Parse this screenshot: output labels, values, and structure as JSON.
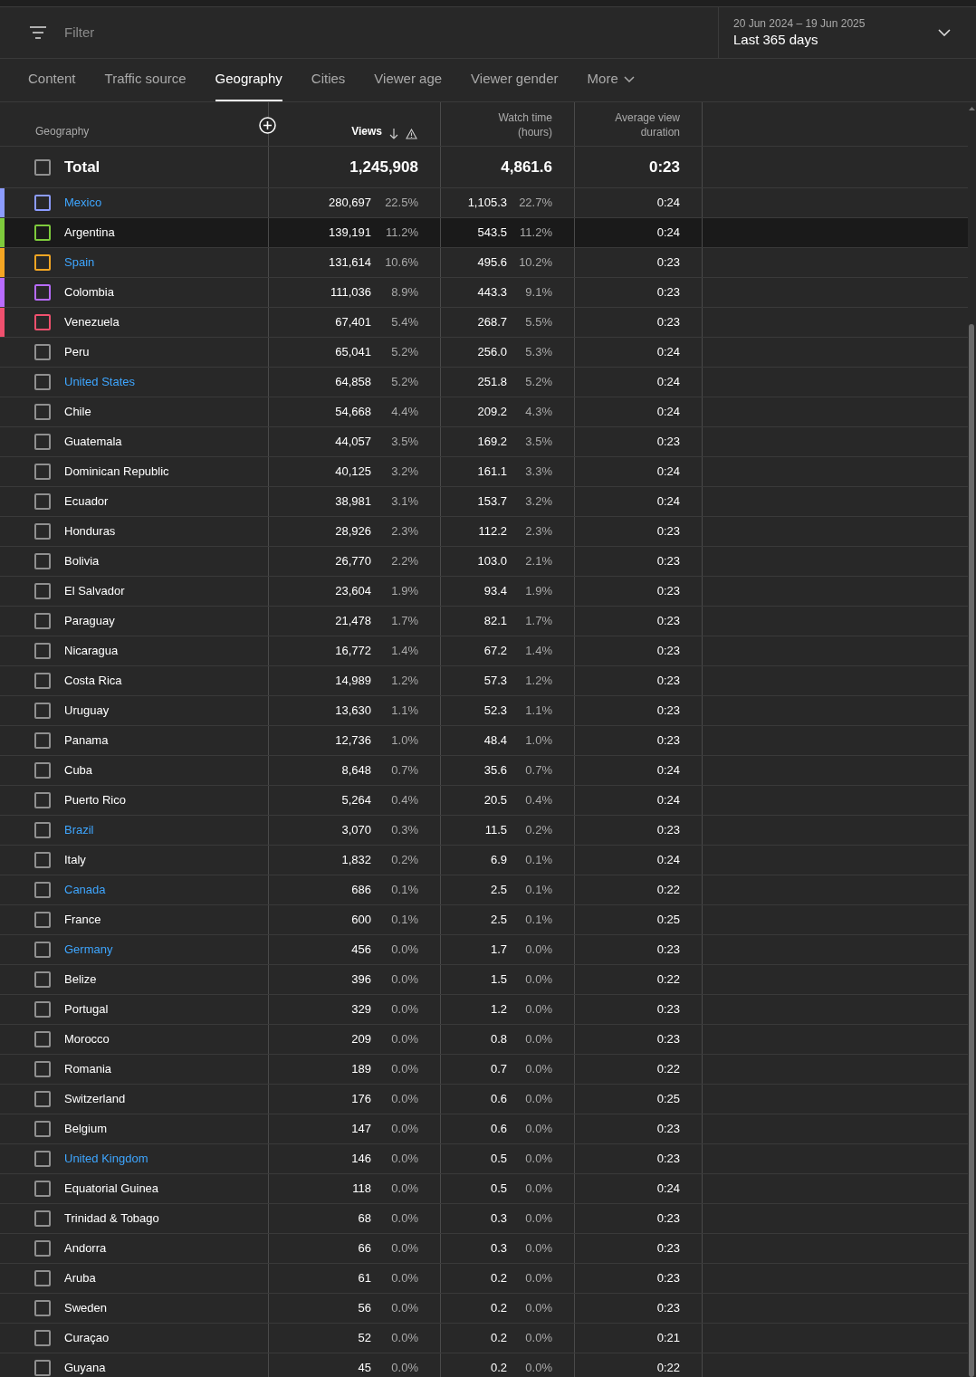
{
  "filter": {
    "placeholder": "Filter"
  },
  "date_range": {
    "range": "20 Jun 2024 – 19 Jun 2025",
    "label": "Last 365 days"
  },
  "tabs": [
    {
      "label": "Content",
      "selected": false
    },
    {
      "label": "Traffic source",
      "selected": false
    },
    {
      "label": "Geography",
      "selected": true
    },
    {
      "label": "Cities",
      "selected": false
    },
    {
      "label": "Viewer age",
      "selected": false
    },
    {
      "label": "Viewer gender",
      "selected": false
    },
    {
      "label": "More",
      "selected": false,
      "kind": "menu"
    }
  ],
  "table": {
    "columns": [
      "Geography",
      "Views",
      "Watch time\n(hours)",
      "Average view\nduration"
    ],
    "total": {
      "label": "Total",
      "checked": false,
      "views": "1,245,908",
      "watch_time": "4,861.6",
      "avg_duration": "0:23"
    },
    "rows": [
      {
        "name": "Mexico",
        "link": true,
        "checked": false,
        "highlighted": false,
        "color": "#8c9cff",
        "views": "280,697",
        "views_pct": "22.5%",
        "watch": "1,105.3",
        "watch_pct": "22.7%",
        "avg": "0:24"
      },
      {
        "name": "Argentina",
        "link": false,
        "checked": false,
        "highlighted": true,
        "color": "#7ecb3c",
        "views": "139,191",
        "views_pct": "11.2%",
        "watch": "543.5",
        "watch_pct": "11.2%",
        "avg": "0:24"
      },
      {
        "name": "Spain",
        "link": true,
        "checked": false,
        "highlighted": false,
        "color": "#f5a623",
        "views": "131,614",
        "views_pct": "10.6%",
        "watch": "495.6",
        "watch_pct": "10.2%",
        "avg": "0:23"
      },
      {
        "name": "Colombia",
        "link": false,
        "checked": false,
        "highlighted": false,
        "color": "#b86bff",
        "views": "111,036",
        "views_pct": "8.9%",
        "watch": "443.3",
        "watch_pct": "9.1%",
        "avg": "0:23"
      },
      {
        "name": "Venezuela",
        "link": false,
        "checked": false,
        "highlighted": false,
        "color": "#f0506e",
        "views": "67,401",
        "views_pct": "5.4%",
        "watch": "268.7",
        "watch_pct": "5.5%",
        "avg": "0:23"
      },
      {
        "name": "Peru",
        "link": false,
        "checked": false,
        "highlighted": false,
        "views": "65,041",
        "views_pct": "5.2%",
        "watch": "256.0",
        "watch_pct": "5.3%",
        "avg": "0:24"
      },
      {
        "name": "United States",
        "link": true,
        "checked": false,
        "highlighted": false,
        "views": "64,858",
        "views_pct": "5.2%",
        "watch": "251.8",
        "watch_pct": "5.2%",
        "avg": "0:24"
      },
      {
        "name": "Chile",
        "link": false,
        "checked": false,
        "highlighted": false,
        "views": "54,668",
        "views_pct": "4.4%",
        "watch": "209.2",
        "watch_pct": "4.3%",
        "avg": "0:24"
      },
      {
        "name": "Guatemala",
        "link": false,
        "checked": false,
        "highlighted": false,
        "views": "44,057",
        "views_pct": "3.5%",
        "watch": "169.2",
        "watch_pct": "3.5%",
        "avg": "0:23"
      },
      {
        "name": "Dominican Republic",
        "link": false,
        "checked": false,
        "highlighted": false,
        "views": "40,125",
        "views_pct": "3.2%",
        "watch": "161.1",
        "watch_pct": "3.3%",
        "avg": "0:24"
      },
      {
        "name": "Ecuador",
        "link": false,
        "checked": false,
        "highlighted": false,
        "views": "38,981",
        "views_pct": "3.1%",
        "watch": "153.7",
        "watch_pct": "3.2%",
        "avg": "0:24"
      },
      {
        "name": "Honduras",
        "link": false,
        "checked": false,
        "highlighted": false,
        "views": "28,926",
        "views_pct": "2.3%",
        "watch": "112.2",
        "watch_pct": "2.3%",
        "avg": "0:23"
      },
      {
        "name": "Bolivia",
        "link": false,
        "checked": false,
        "highlighted": false,
        "views": "26,770",
        "views_pct": "2.2%",
        "watch": "103.0",
        "watch_pct": "2.1%",
        "avg": "0:23"
      },
      {
        "name": "El Salvador",
        "link": false,
        "checked": false,
        "highlighted": false,
        "views": "23,604",
        "views_pct": "1.9%",
        "watch": "93.4",
        "watch_pct": "1.9%",
        "avg": "0:23"
      },
      {
        "name": "Paraguay",
        "link": false,
        "checked": false,
        "highlighted": false,
        "views": "21,478",
        "views_pct": "1.7%",
        "watch": "82.1",
        "watch_pct": "1.7%",
        "avg": "0:23"
      },
      {
        "name": "Nicaragua",
        "link": false,
        "checked": false,
        "highlighted": false,
        "views": "16,772",
        "views_pct": "1.4%",
        "watch": "67.2",
        "watch_pct": "1.4%",
        "avg": "0:23"
      },
      {
        "name": "Costa Rica",
        "link": false,
        "checked": false,
        "highlighted": false,
        "views": "14,989",
        "views_pct": "1.2%",
        "watch": "57.3",
        "watch_pct": "1.2%",
        "avg": "0:23"
      },
      {
        "name": "Uruguay",
        "link": false,
        "checked": false,
        "highlighted": false,
        "views": "13,630",
        "views_pct": "1.1%",
        "watch": "52.3",
        "watch_pct": "1.1%",
        "avg": "0:23"
      },
      {
        "name": "Panama",
        "link": false,
        "checked": false,
        "highlighted": false,
        "views": "12,736",
        "views_pct": "1.0%",
        "watch": "48.4",
        "watch_pct": "1.0%",
        "avg": "0:23"
      },
      {
        "name": "Cuba",
        "link": false,
        "checked": false,
        "highlighted": false,
        "views": "8,648",
        "views_pct": "0.7%",
        "watch": "35.6",
        "watch_pct": "0.7%",
        "avg": "0:24"
      },
      {
        "name": "Puerto Rico",
        "link": false,
        "checked": false,
        "highlighted": false,
        "views": "5,264",
        "views_pct": "0.4%",
        "watch": "20.5",
        "watch_pct": "0.4%",
        "avg": "0:24"
      },
      {
        "name": "Brazil",
        "link": true,
        "checked": false,
        "highlighted": false,
        "views": "3,070",
        "views_pct": "0.3%",
        "watch": "11.5",
        "watch_pct": "0.2%",
        "avg": "0:23"
      },
      {
        "name": "Italy",
        "link": false,
        "checked": false,
        "highlighted": false,
        "views": "1,832",
        "views_pct": "0.2%",
        "watch": "6.9",
        "watch_pct": "0.1%",
        "avg": "0:24"
      },
      {
        "name": "Canada",
        "link": true,
        "checked": false,
        "highlighted": false,
        "views": "686",
        "views_pct": "0.1%",
        "watch": "2.5",
        "watch_pct": "0.1%",
        "avg": "0:22"
      },
      {
        "name": "France",
        "link": false,
        "checked": false,
        "highlighted": false,
        "views": "600",
        "views_pct": "0.1%",
        "watch": "2.5",
        "watch_pct": "0.1%",
        "avg": "0:25"
      },
      {
        "name": "Germany",
        "link": true,
        "checked": false,
        "highlighted": false,
        "views": "456",
        "views_pct": "0.0%",
        "watch": "1.7",
        "watch_pct": "0.0%",
        "avg": "0:23"
      },
      {
        "name": "Belize",
        "link": false,
        "checked": false,
        "highlighted": false,
        "views": "396",
        "views_pct": "0.0%",
        "watch": "1.5",
        "watch_pct": "0.0%",
        "avg": "0:22"
      },
      {
        "name": "Portugal",
        "link": false,
        "checked": false,
        "highlighted": false,
        "views": "329",
        "views_pct": "0.0%",
        "watch": "1.2",
        "watch_pct": "0.0%",
        "avg": "0:23"
      },
      {
        "name": "Morocco",
        "link": false,
        "checked": false,
        "highlighted": false,
        "views": "209",
        "views_pct": "0.0%",
        "watch": "0.8",
        "watch_pct": "0.0%",
        "avg": "0:23"
      },
      {
        "name": "Romania",
        "link": false,
        "checked": false,
        "highlighted": false,
        "views": "189",
        "views_pct": "0.0%",
        "watch": "0.7",
        "watch_pct": "0.0%",
        "avg": "0:22"
      },
      {
        "name": "Switzerland",
        "link": false,
        "checked": false,
        "highlighted": false,
        "views": "176",
        "views_pct": "0.0%",
        "watch": "0.6",
        "watch_pct": "0.0%",
        "avg": "0:25"
      },
      {
        "name": "Belgium",
        "link": false,
        "checked": false,
        "highlighted": false,
        "views": "147",
        "views_pct": "0.0%",
        "watch": "0.6",
        "watch_pct": "0.0%",
        "avg": "0:23"
      },
      {
        "name": "United Kingdom",
        "link": true,
        "checked": false,
        "highlighted": false,
        "views": "146",
        "views_pct": "0.0%",
        "watch": "0.5",
        "watch_pct": "0.0%",
        "avg": "0:23"
      },
      {
        "name": "Equatorial Guinea",
        "link": false,
        "checked": false,
        "highlighted": false,
        "views": "118",
        "views_pct": "0.0%",
        "watch": "0.5",
        "watch_pct": "0.0%",
        "avg": "0:24"
      },
      {
        "name": "Trinidad & Tobago",
        "link": false,
        "checked": false,
        "highlighted": false,
        "views": "68",
        "views_pct": "0.0%",
        "watch": "0.3",
        "watch_pct": "0.0%",
        "avg": "0:23"
      },
      {
        "name": "Andorra",
        "link": false,
        "checked": false,
        "highlighted": false,
        "views": "66",
        "views_pct": "0.0%",
        "watch": "0.3",
        "watch_pct": "0.0%",
        "avg": "0:23"
      },
      {
        "name": "Aruba",
        "link": false,
        "checked": false,
        "highlighted": false,
        "views": "61",
        "views_pct": "0.0%",
        "watch": "0.2",
        "watch_pct": "0.0%",
        "avg": "0:23"
      },
      {
        "name": "Sweden",
        "link": false,
        "checked": false,
        "highlighted": false,
        "views": "56",
        "views_pct": "0.0%",
        "watch": "0.2",
        "watch_pct": "0.0%",
        "avg": "0:23"
      },
      {
        "name": "Curaçao",
        "link": false,
        "checked": false,
        "highlighted": false,
        "views": "52",
        "views_pct": "0.0%",
        "watch": "0.2",
        "watch_pct": "0.0%",
        "avg": "0:21"
      },
      {
        "name": "Guyana",
        "link": false,
        "checked": false,
        "highlighted": false,
        "views": "45",
        "views_pct": "0.0%",
        "watch": "0.2",
        "watch_pct": "0.0%",
        "avg": "0:22"
      }
    ]
  }
}
